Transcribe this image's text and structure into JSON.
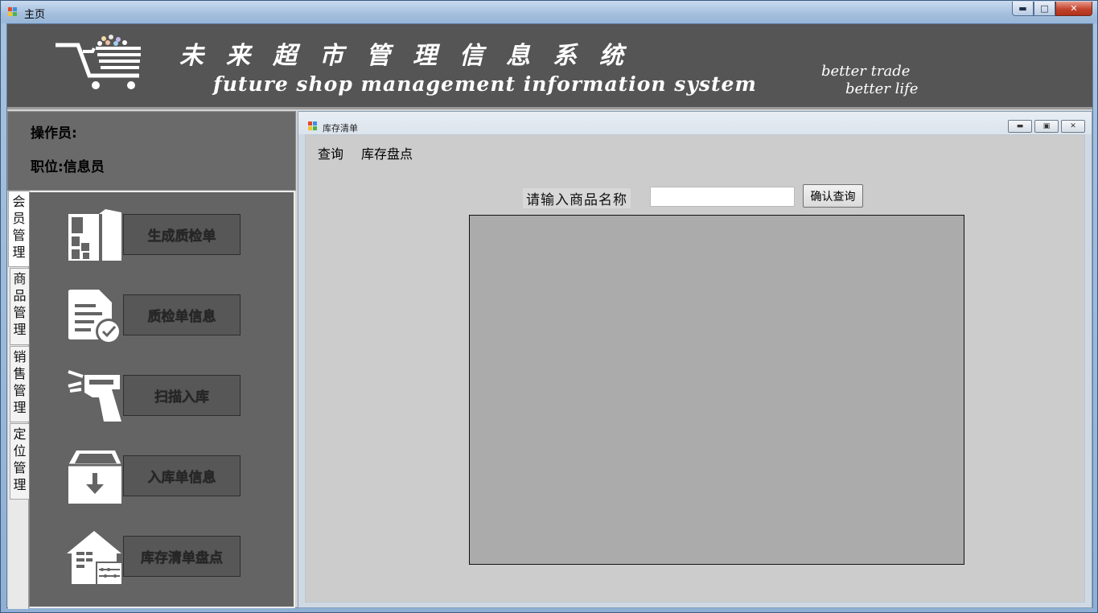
{
  "window": {
    "title": "主页",
    "minimize_icon": "minimize-icon",
    "maximize_icon": "maximize-icon",
    "close_icon": "close-icon"
  },
  "banner": {
    "title_cn": "未来超市管理信息系统",
    "title_en": "future shop management information system",
    "slogan_line1": "better trade",
    "slogan_line2": "better life"
  },
  "operator": {
    "operator_label": "操作员:",
    "position_label": "职位:信息员"
  },
  "vertical_tabs": [
    {
      "label": "会员管理"
    },
    {
      "label": "商品管理"
    },
    {
      "label": "销售管理"
    },
    {
      "label": "定位管理"
    }
  ],
  "menu_items": [
    {
      "label": "生成质检单",
      "icon": "building-icon"
    },
    {
      "label": "质检单信息",
      "icon": "document-check-icon"
    },
    {
      "label": "扫描入库",
      "icon": "barcode-scanner-icon"
    },
    {
      "label": "入库单信息",
      "icon": "inbox-download-icon"
    },
    {
      "label": "库存清单盘点",
      "icon": "warehouse-abacus-icon"
    }
  ],
  "child_window": {
    "title": "库存清单",
    "menubar": [
      "查询",
      "库存盘点"
    ],
    "query_label": "请输入商品名称",
    "query_value": "",
    "confirm_button": "确认查询"
  }
}
